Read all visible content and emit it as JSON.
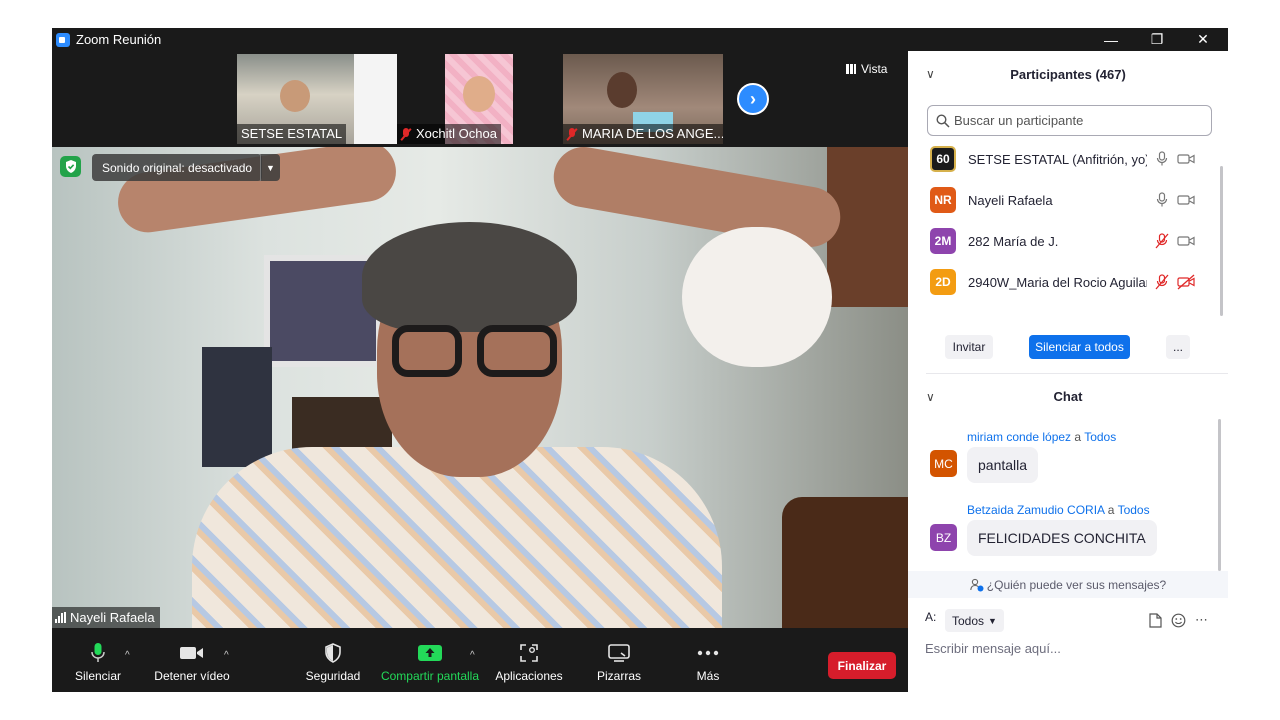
{
  "window": {
    "title": "Zoom Reunión"
  },
  "video": {
    "view_label": "Vista",
    "thumbnails": [
      {
        "name": "SETSE ESTATAL",
        "muted": false
      },
      {
        "name": "Xochitl Ochoa",
        "muted": true
      },
      {
        "name": "MARIA DE LOS ANGE...",
        "muted": true
      }
    ],
    "audio_status": "Sonido original: desactivado",
    "speaker_name": "Nayeli Rafaela"
  },
  "toolbar": {
    "mute": "Silenciar",
    "stop_video": "Detener vídeo",
    "security": "Seguridad",
    "share_screen": "Compartir pantalla",
    "apps": "Aplicaciones",
    "whiteboards": "Pizarras",
    "more": "Más",
    "end": "Finalizar"
  },
  "participants": {
    "title": "Participantes (467)",
    "search_placeholder": "Buscar un participante",
    "list": [
      {
        "initials": "60",
        "name": "SETSE ESTATAL (Anfitrión, yo)",
        "color": "#1b1b1b",
        "mic": "on",
        "video": "on"
      },
      {
        "initials": "NR",
        "name": "Nayeli Rafaela",
        "color": "#e05a17",
        "mic": "on",
        "video": "on"
      },
      {
        "initials": "2M",
        "name": "282 María de J.",
        "color": "#8e44ad",
        "mic": "muted",
        "video": "on"
      },
      {
        "initials": "2D",
        "name": "2940W_Maria del Rocio Aguilar",
        "color": "#f39c12",
        "mic": "muted",
        "video": "off"
      }
    ],
    "invite": "Invitar",
    "mute_all": "Silenciar a todos",
    "more": "..."
  },
  "chat": {
    "title": "Chat",
    "messages": [
      {
        "initials": "MC",
        "color": "#d35400",
        "from": "miriam conde lópez",
        "to_word": "a",
        "to": "Todos",
        "text": "pantalla"
      },
      {
        "initials": "BZ",
        "color": "#8e44ad",
        "from": "Betzaida Zamudio CORIA",
        "to_word": "a",
        "to": "Todos",
        "text": "FELICIDADES CONCHITA"
      }
    ],
    "who_can_see": "¿Quién puede ver sus mensajes?",
    "to_label": "A:",
    "to_value": "Todos",
    "input_placeholder": "Escribir mensaje aquí..."
  },
  "colors": {
    "accent": "#0e71eb",
    "share_green": "#23d959",
    "end_red": "#d61d2b",
    "mute_red": "#e02828"
  }
}
